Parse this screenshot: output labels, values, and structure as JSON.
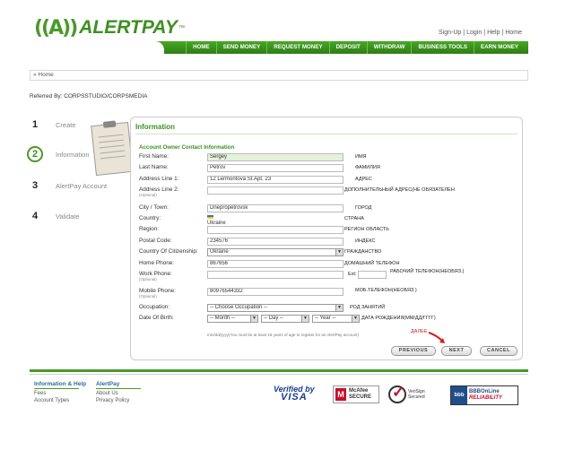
{
  "brand": {
    "logo_mark": "((A))",
    "name": "ALERTPAY",
    "tm": "™"
  },
  "top_links": [
    "Sign-Up",
    "Login",
    "Help",
    "Home"
  ],
  "nav": [
    "HOME",
    "SEND MONEY",
    "REQUEST MONEY",
    "DEPOSIT",
    "WITHDRAW",
    "BUSINESS TOOLS",
    "EARN MONEY"
  ],
  "breadcrumb": "» Home",
  "referred_by": "Referred By: CORPSSTUDIO/CORPSMEDIA",
  "steps": [
    {
      "num": "1",
      "label": "Create"
    },
    {
      "num": "2",
      "label": "Information"
    },
    {
      "num": "3",
      "label": "AlertPay Account"
    },
    {
      "num": "4",
      "label": "Validate"
    }
  ],
  "form": {
    "title": "Information",
    "section": "Account Owner Contact Information",
    "first_name": {
      "label": "First Name:",
      "value": "Sergey",
      "note": "ИМЯ"
    },
    "last_name": {
      "label": "Last Name:",
      "value": "Petrov",
      "note": "ФАМИЛИЯ"
    },
    "address1": {
      "label": "Address Line 1:",
      "value": "12 Lermontova St.Apt. 23",
      "note": "АДРЕС"
    },
    "address2": {
      "label": "Address Line 2:",
      "sub": "(Optional)",
      "value": "",
      "note": "ДОПОЛНИТЕЛЬНЫЙ АДРЕС(НЕ ОБЯЗАТЕЛЕН"
    },
    "city": {
      "label": "City / Town:",
      "value": "Dnepropetrovsk",
      "note": "ГОРОД"
    },
    "country": {
      "label": "Country:",
      "value": "Ukraine",
      "note": "СТРАНА"
    },
    "region": {
      "label": "Region:",
      "value": "",
      "note": "РЕГИОН ОБЛАСТЬ"
    },
    "postal": {
      "label": "Postal Code:",
      "value": "234576",
      "note": "ИНДЕКС"
    },
    "citizenship": {
      "label": "Country Of Citizenship:",
      "value": "Ukraine",
      "note": "ГРАЖДАНСТВО"
    },
    "home_phone": {
      "label": "Home Phone:",
      "value": "867656",
      "note": "ДОМАШНИЙ ТЕЛЕФОН"
    },
    "work_phone": {
      "label": "Work Phone:",
      "sub": "(Optional)",
      "value": "",
      "ext_label": "Ext:",
      "note": "РАБОЧИЙ ТЕЛЕФОН(НЕОБЯЗ.)"
    },
    "mobile_phone": {
      "label": "Mobile Phone:",
      "sub": "(Optional)",
      "value": "80976544332",
      "note": "МОБ.ТЕЛЕФОН(НЕОБЯЗ.)"
    },
    "occupation": {
      "label": "Occupation:",
      "value": "-- Choose Occupation --",
      "note": "РОД ЗАНЯТИЙ"
    },
    "dob": {
      "label": "Date Of Birth:",
      "month": "-- Month --",
      "day": "-- Day --",
      "year": "-- Year --",
      "note": "ДАТА РОЖДЕНИЯ(ММ/ДД/ГГГГ)"
    },
    "dob_hint": "mm/dd/yyyy(You must be at least 18 years of age to register for an AlertPay account)",
    "next_note": "ДАЛЕЕ",
    "buttons": {
      "previous": "PREVIOUS",
      "next": "NEXT",
      "cancel": "CANCEL"
    }
  },
  "footer": {
    "col1": {
      "head": "Information & Help",
      "items": [
        "Fees",
        "Account Types"
      ]
    },
    "col2": {
      "head": "AlertPay",
      "items": [
        "About Us",
        "Privacy Policy"
      ]
    },
    "badges": {
      "vbv_top": "Verified by",
      "vbv_bottom": "VISA",
      "mcafee_top": "McAfee",
      "mcafee_bottom": "SECURE",
      "verisign_top": "VeriSign",
      "verisign_bottom": "Secured",
      "bbb_top": "BBBOnLine",
      "bbb_bottom": "RELIABILITY"
    }
  },
  "colors": {
    "brand_green": "#3e8f24",
    "nav_green": "#2f7d15",
    "alert_red": "#d02020"
  }
}
